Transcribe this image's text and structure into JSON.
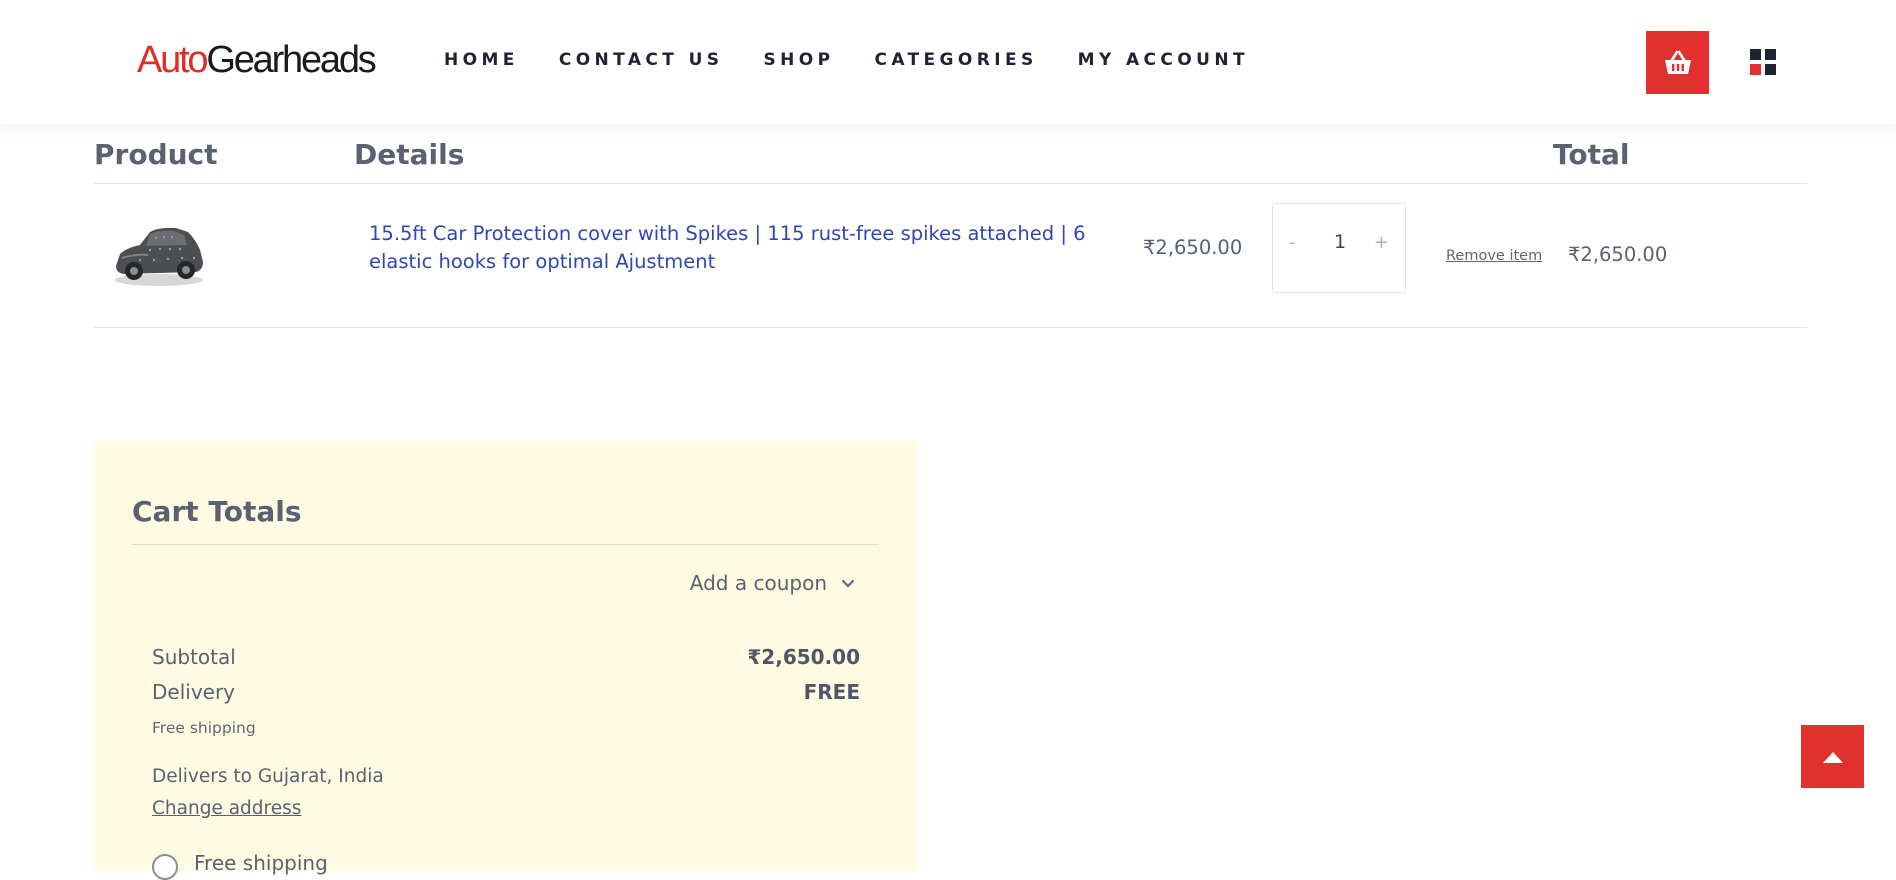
{
  "header": {
    "logo": {
      "part_a": "Auto",
      "part_b": "Gearheads"
    },
    "nav": [
      {
        "label": "HOME"
      },
      {
        "label": "CONTACT US"
      },
      {
        "label": "SHOP"
      },
      {
        "label": "CATEGORIES"
      },
      {
        "label": "MY ACCOUNT"
      }
    ],
    "cart_icon": "basket-icon",
    "menu_icon": "grid-menu-icon",
    "colors": {
      "accent": "#e1302d",
      "grid_dark": "#1f2333",
      "grid_accent": "#e1302d"
    }
  },
  "cart": {
    "columns": {
      "product": "Product",
      "details": "Details",
      "total": "Total"
    },
    "items": [
      {
        "name": "15.5ft Car Protection cover with Spikes | 115 rust-free spikes attached | 6 elastic hooks for optimal Ajustment",
        "price": "₹2,650.00",
        "quantity": "1",
        "minus": "-",
        "plus": "+",
        "remove_label": "Remove item",
        "line_total": "₹2,650.00"
      }
    ]
  },
  "totals": {
    "title": "Cart Totals",
    "coupon_label": "Add a coupon",
    "subtotal_label": "Subtotal",
    "subtotal_value": "₹2,650.00",
    "delivery_label": "Delivery",
    "delivery_value": "FREE",
    "delivery_note": "Free shipping",
    "delivers_to": "Delivers to Gujarat, India",
    "change_address": "Change address",
    "shipping_option": "Free shipping",
    "panel_color": "#fffbe3"
  },
  "back_to_top_icon": "arrow-up-icon"
}
